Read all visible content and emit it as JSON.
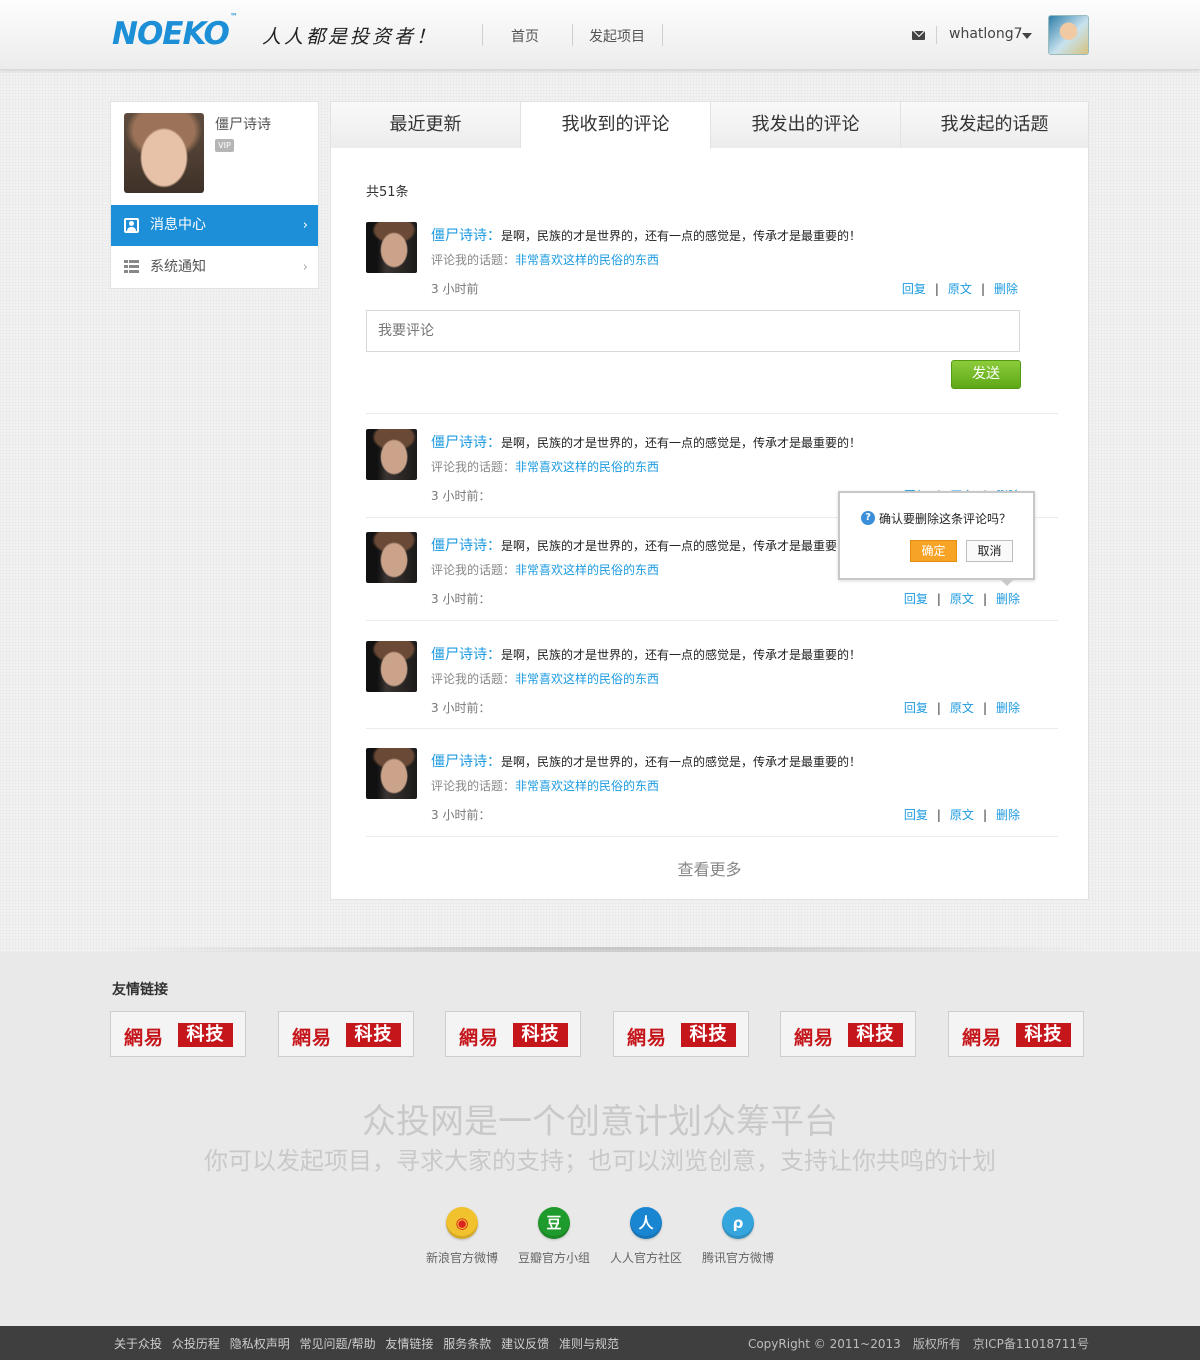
{
  "header": {
    "logo": "NOEKO",
    "logo_tm": "™",
    "slogan": "人人都是投资者！",
    "nav": [
      "首页",
      "发起项目"
    ],
    "username": "whatlong7"
  },
  "sidebar": {
    "name": "僵尸诗诗",
    "vip": "VIP",
    "items": [
      {
        "label": "消息中心",
        "active": true
      },
      {
        "label": "系统通知",
        "active": false
      }
    ]
  },
  "tabs": [
    {
      "label": "最近更新",
      "active": false
    },
    {
      "label": "我收到的评论",
      "active": true
    },
    {
      "label": "我发出的评论",
      "active": false
    },
    {
      "label": "我发起的话题",
      "active": false
    }
  ],
  "total_label": "共51条",
  "comments": [
    {
      "author": "僵尸诗诗：",
      "text": "是啊，民族的才是世界的，还有一点的感觉是，传承才是最重要的！",
      "topic_prefix": "评论我的话题：",
      "topic": "非常喜欢这样的民俗的东西",
      "time": "3 小时前",
      "reply": "回复",
      "origin": "原文",
      "delete": "删除"
    },
    {
      "author": "僵尸诗诗：",
      "text": "是啊，民族的才是世界的，还有一点的感觉是，传承才是最重要的！",
      "topic_prefix": "评论我的话题：",
      "topic": "非常喜欢这样的民俗的东西",
      "time": "3 小时前：",
      "reply": "回复",
      "origin": "原文",
      "delete": "删除"
    },
    {
      "author": "僵尸诗诗：",
      "text": "是啊，民族的才是世界的，还有一点的感觉是，传承才是最重要的！",
      "topic_prefix": "评论我的话题：",
      "topic": "非常喜欢这样的民俗的东西",
      "time": "3 小时前：",
      "reply": "回复",
      "origin": "原文",
      "delete": "删除"
    },
    {
      "author": "僵尸诗诗：",
      "text": "是啊，民族的才是世界的，还有一点的感觉是，传承才是最重要的！",
      "topic_prefix": "评论我的话题：",
      "topic": "非常喜欢这样的民俗的东西",
      "time": "3 小时前：",
      "reply": "回复",
      "origin": "原文",
      "delete": "删除"
    },
    {
      "author": "僵尸诗诗：",
      "text": "是啊，民族的才是世界的，还有一点的感觉是，传承才是最重要的！",
      "topic_prefix": "评论我的话题：",
      "topic": "非常喜欢这样的民俗的东西",
      "time": "3 小时前：",
      "reply": "回复",
      "origin": "原文",
      "delete": "删除"
    }
  ],
  "reply_box": {
    "placeholder": "我要评论",
    "send": "发送"
  },
  "more": "查看更多",
  "confirm": {
    "question": "确认要删除这条评论吗？",
    "ok": "确定",
    "cancel": "取消"
  },
  "footer": {
    "links_title": "友情链接",
    "partner": {
      "p1": "網易",
      "p2": "科技"
    },
    "partner_count": 6,
    "headline": "众投网是一个创意计划众筹平台",
    "subline": "你可以发起项目，寻求大家的支持；也可以浏览创意，支持让你共鸣的计划",
    "social": [
      {
        "label": "新浪官方微博",
        "icon": "weibo-icon",
        "color": "#f2c12e"
      },
      {
        "label": "豆瓣官方小组",
        "icon": "douban-icon",
        "color": "#1f9a2c"
      },
      {
        "label": "人人官方社区",
        "icon": "renren-icon",
        "color": "#1a86d1"
      },
      {
        "label": "腾讯官方微博",
        "icon": "tencent-weibo-icon",
        "color": "#35a5de"
      }
    ],
    "bottom_links": [
      "关于众投",
      "众投历程",
      "隐私权声明",
      "常见问题/帮助",
      "友情链接",
      "服务条款",
      "建议反馈",
      "准则与规范"
    ],
    "copyright": "CopyRight © 2011~2013　版权所有　京ICP备11018711号"
  }
}
